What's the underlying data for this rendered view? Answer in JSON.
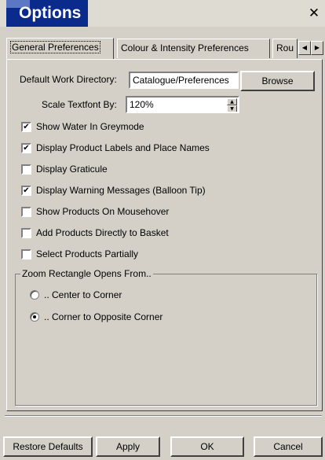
{
  "window": {
    "title": "Options",
    "close_glyph": "✕"
  },
  "tabs": [
    {
      "label": "General Preferences",
      "selected": true
    },
    {
      "label": "Colour & Intensity Preferences",
      "selected": false
    },
    {
      "label": "Rou",
      "selected": false
    }
  ],
  "tab_scroll": {
    "left_icon": "◀",
    "right_icon": "▶"
  },
  "general": {
    "work_dir_label": "Default Work Directory:",
    "work_dir_value": "Catalogue/Preferences",
    "browse_label": "Browse",
    "scale_label": "Scale Textfont By:",
    "scale_value": "120%",
    "spin_up": "▲",
    "spin_down": "▼"
  },
  "checkboxes": [
    {
      "label": "Show Water In Greymode",
      "checked": true
    },
    {
      "label": "Display Product Labels and Place Names",
      "checked": true
    },
    {
      "label": "Display Graticule",
      "checked": false
    },
    {
      "label": "Display Warning Messages (Balloon Tip)",
      "checked": true
    },
    {
      "label": "Show Products On Mousehover",
      "checked": false
    },
    {
      "label": "Add Products Directly to Basket",
      "checked": false
    },
    {
      "label": "Select Products Partially",
      "checked": false
    }
  ],
  "check_glyph": "✔",
  "zoom_group": {
    "title": "Zoom Rectangle Opens From..",
    "options": [
      {
        "label": ".. Center to Corner",
        "selected": false
      },
      {
        "label": ".. Corner to Opposite Corner",
        "selected": true
      }
    ]
  },
  "footer": {
    "restore_label": "Restore Defaults",
    "apply_label": "Apply",
    "ok_label": "OK",
    "cancel_label": "Cancel"
  }
}
